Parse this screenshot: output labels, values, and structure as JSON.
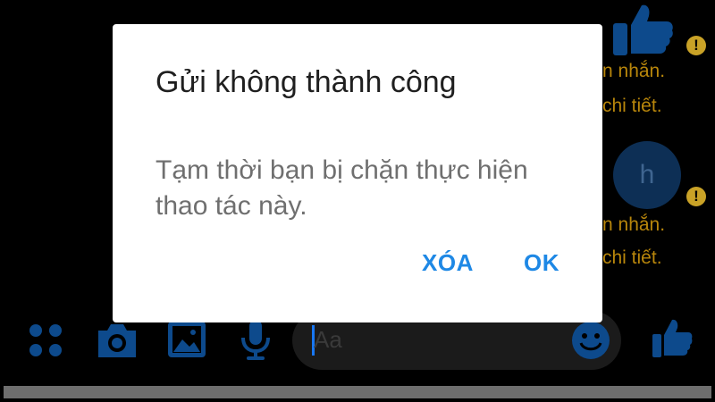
{
  "dialog": {
    "title": "Gửi không thành công",
    "message": "Tạm thời bạn bị chặn thực hiện thao tác này.",
    "delete_label": "XÓA",
    "ok_label": "OK"
  },
  "chat": {
    "msg1_line1": "n nhắn.",
    "msg1_line2": "chi tiết.",
    "msg2_line1": "n nhắn.",
    "msg2_line2": "chi tiết.",
    "avatar_letter": "h",
    "warning_mark": "!"
  },
  "composer": {
    "placeholder": "Aa"
  },
  "colors": {
    "accent": "#1877f2",
    "button_text": "#1e88e5",
    "warning": "#c9a227"
  },
  "icons": [
    "apps-icon",
    "camera-icon",
    "image-icon",
    "microphone-icon",
    "emoji-icon",
    "like-icon",
    "warning-icon"
  ]
}
